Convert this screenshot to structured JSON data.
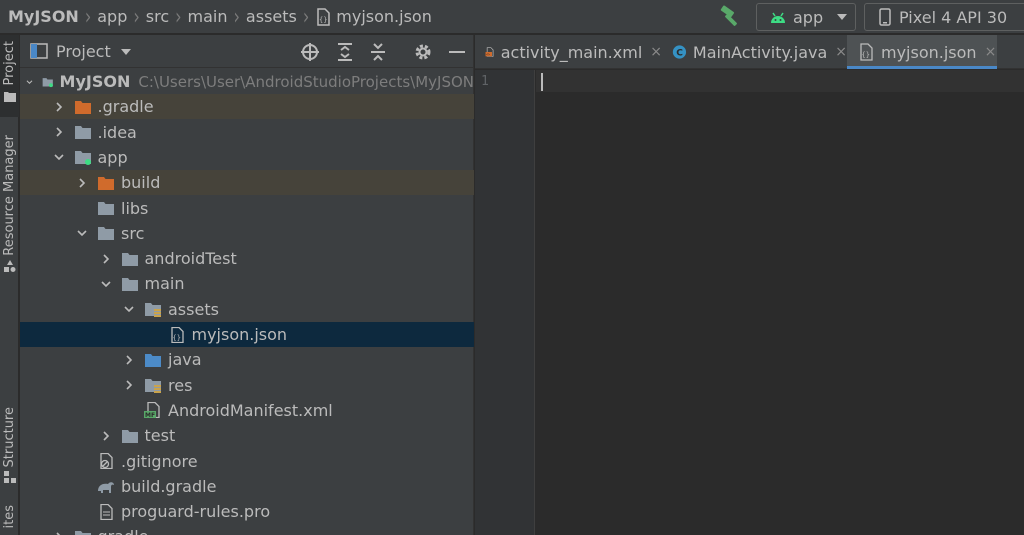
{
  "breadcrumb": [
    "MyJSON",
    "app",
    "src",
    "main",
    "assets",
    "myjson.json"
  ],
  "run_config": {
    "label": "app"
  },
  "device": {
    "label": "Pixel 4 API 30"
  },
  "toolstrip": {
    "tabs": [
      "Project",
      "Resource Manager",
      "Structure",
      "ites"
    ]
  },
  "project_panel": {
    "title": "Project",
    "tree": [
      {
        "name": "MyJSON",
        "path": "C:\\Users\\User\\AndroidStudioProjects\\MyJSON",
        "depth": 0,
        "expanded": true,
        "icon": "module-folder-icon"
      },
      {
        "name": ".gradle",
        "depth": 1,
        "expanded": false,
        "icon": "excluded-folder-icon",
        "excluded": true
      },
      {
        "name": ".idea",
        "depth": 1,
        "expanded": false,
        "icon": "folder-icon"
      },
      {
        "name": "app",
        "depth": 1,
        "expanded": true,
        "icon": "module-folder-icon"
      },
      {
        "name": "build",
        "depth": 2,
        "expanded": false,
        "icon": "excluded-folder-icon",
        "excluded": true
      },
      {
        "name": "libs",
        "depth": 2,
        "leaf": true,
        "icon": "folder-icon"
      },
      {
        "name": "src",
        "depth": 2,
        "expanded": true,
        "icon": "folder-icon"
      },
      {
        "name": "androidTest",
        "depth": 3,
        "expanded": false,
        "icon": "folder-icon"
      },
      {
        "name": "main",
        "depth": 3,
        "expanded": true,
        "icon": "folder-icon"
      },
      {
        "name": "assets",
        "depth": 4,
        "expanded": true,
        "icon": "resources-folder-icon"
      },
      {
        "name": "myjson.json",
        "depth": 5,
        "leaf": true,
        "icon": "json-file-icon",
        "selected": true
      },
      {
        "name": "java",
        "depth": 4,
        "expanded": false,
        "icon": "source-folder-icon"
      },
      {
        "name": "res",
        "depth": 4,
        "expanded": false,
        "icon": "resources-folder-icon"
      },
      {
        "name": "AndroidManifest.xml",
        "depth": 4,
        "leaf": true,
        "icon": "manifest-file-icon"
      },
      {
        "name": "test",
        "depth": 3,
        "expanded": false,
        "icon": "folder-icon"
      },
      {
        "name": ".gitignore",
        "depth": 2,
        "leaf": true,
        "icon": "gitignore-file-icon"
      },
      {
        "name": "build.gradle",
        "depth": 2,
        "leaf": true,
        "icon": "gradle-file-icon"
      },
      {
        "name": "proguard-rules.pro",
        "depth": 2,
        "leaf": true,
        "icon": "text-file-icon"
      },
      {
        "name": "gradle",
        "depth": 1,
        "expanded": false,
        "icon": "folder-icon"
      }
    ]
  },
  "editor": {
    "tabs": [
      {
        "label": "activity_main.xml",
        "icon": "layout-xml-icon",
        "active": false
      },
      {
        "label": "MainActivity.java",
        "icon": "java-class-icon",
        "active": false
      },
      {
        "label": "myjson.json",
        "icon": "json-file-icon",
        "active": true
      }
    ],
    "line_numbers": [
      "1"
    ]
  },
  "colors": {
    "background": "#2b2b2b",
    "panel": "#3c3f41",
    "selection": "#0d293e",
    "excluded": "#46433a",
    "accent": "#4a88c7",
    "android_green": "#3ddc84"
  }
}
